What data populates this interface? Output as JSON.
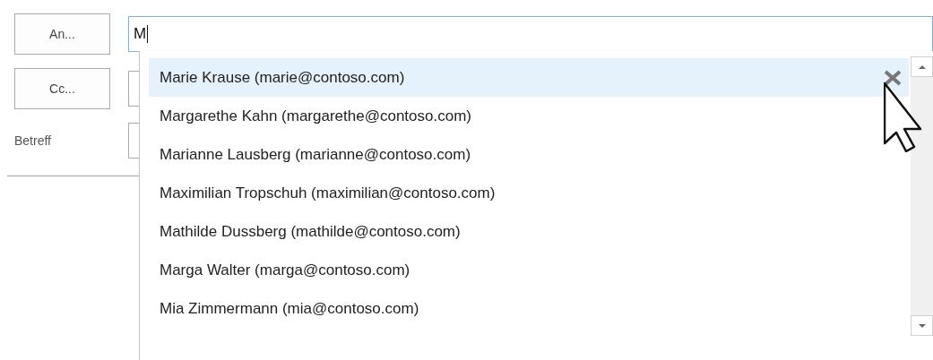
{
  "recipients": [
    {
      "button": "An...",
      "value": "M"
    },
    {
      "button": "Cc..."
    }
  ],
  "subject": {
    "label": "Betreff"
  },
  "suggestions": [
    {
      "text": "Marie Krause (marie@contoso.com)",
      "selected": true
    },
    {
      "text": "Margarethe Kahn (margarethe@contoso.com)",
      "selected": false
    },
    {
      "text": "Marianne Lausberg (marianne@contoso.com)",
      "selected": false
    },
    {
      "text": "Maximilian Tropschuh (maximilian@contoso.com)",
      "selected": false
    },
    {
      "text": "Mathilde Dussberg (mathilde@contoso.com)",
      "selected": false
    },
    {
      "text": "Marga Walter (marga@contoso.com)",
      "selected": false
    },
    {
      "text": "Mia Zimmermann (mia@contoso.com)",
      "selected": false
    }
  ]
}
